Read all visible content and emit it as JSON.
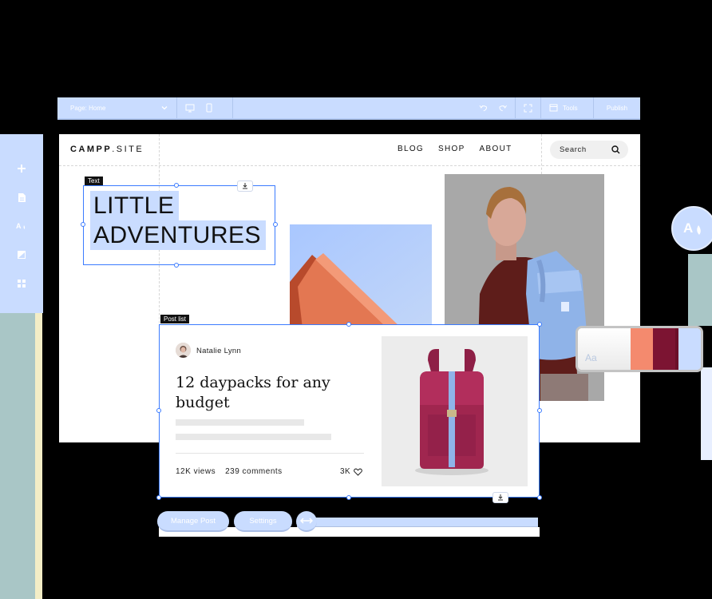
{
  "editor": {
    "page_select": "Page: Home",
    "tools_label": "Tools",
    "publish_label": "Publish",
    "left_tools": [
      "add-icon",
      "page-icon",
      "theme-icon",
      "media-icon",
      "apps-icon"
    ]
  },
  "site": {
    "logo": "CAMPP.SITE",
    "logo_bold": "CAMPP",
    "logo_rest": ".SITE",
    "nav": [
      "BLOG",
      "SHOP",
      "ABOUT"
    ],
    "search_label": "Search"
  },
  "text_element": {
    "tag": "Text",
    "line1": "LITTLE",
    "line2": "ADVENTURES"
  },
  "post_list": {
    "tag": "Post list",
    "author": "Natalie Lynn",
    "title": "12 daypacks for any budget",
    "views": "12K views",
    "comments": "239 comments",
    "likes": "3K"
  },
  "actions": {
    "manage_post": "Manage Post",
    "settings": "Settings"
  },
  "palette": {
    "sample": "Aa",
    "colors": [
      "#f48a6e",
      "#7c1432",
      "#6b1029",
      "#c9dcff"
    ]
  },
  "colors": {
    "accent": "#c9dcff",
    "selection": "#3b7bff"
  }
}
